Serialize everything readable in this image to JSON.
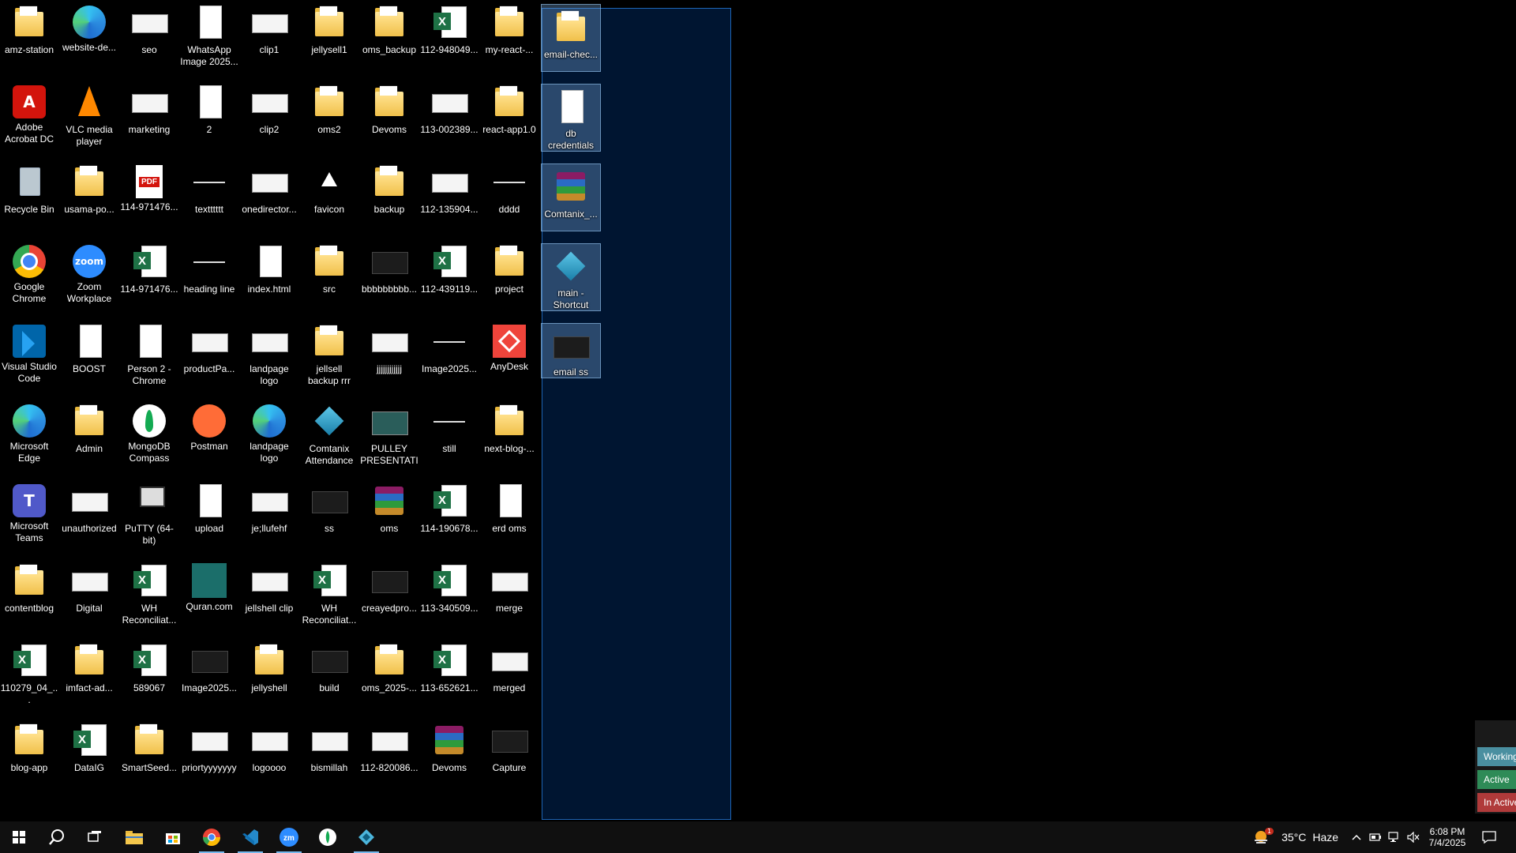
{
  "desktop": {
    "icons": [
      {
        "label": "amz-station",
        "icon": "folder-icon"
      },
      {
        "label": "website-de...",
        "icon": "edge-icon"
      },
      {
        "label": "seo",
        "icon": "thumbnail-icon"
      },
      {
        "label": "WhatsApp Image 2025...",
        "icon": "image-file-icon"
      },
      {
        "label": "clip1",
        "icon": "video-thumbnail-icon"
      },
      {
        "label": "jellysell1",
        "icon": "folder-icon"
      },
      {
        "label": "oms_backup",
        "icon": "folder-icon"
      },
      {
        "label": "112-948049...",
        "icon": "excel-icon"
      },
      {
        "label": "my-react-...",
        "icon": "folder-icon"
      },
      {
        "label": "Adobe Acrobat DC",
        "icon": "adobe-acrobat-icon"
      },
      {
        "label": "VLC media player",
        "icon": "vlc-icon"
      },
      {
        "label": "marketing",
        "icon": "thumbnail-icon"
      },
      {
        "label": "2",
        "icon": "document-icon"
      },
      {
        "label": "clip2",
        "icon": "video-thumbnail-icon"
      },
      {
        "label": "oms2",
        "icon": "folder-icon"
      },
      {
        "label": "Devoms",
        "icon": "folder-icon"
      },
      {
        "label": "113-002389...",
        "icon": "excel-thumbnail-icon"
      },
      {
        "label": "react-app1.0",
        "icon": "folder-icon"
      },
      {
        "label": "Recycle Bin",
        "icon": "recycle-bin-icon"
      },
      {
        "label": "usama-po...",
        "icon": "folder-icon"
      },
      {
        "label": "114-971476...",
        "icon": "pdf-icon"
      },
      {
        "label": "textttttt",
        "icon": "line-thumbnail-icon"
      },
      {
        "label": "onedirector...",
        "icon": "thumbnail-icon"
      },
      {
        "label": "favicon",
        "icon": "triangle-icon"
      },
      {
        "label": "backup",
        "icon": "folder-icon"
      },
      {
        "label": "112-135904...",
        "icon": "excel-thumbnail-icon"
      },
      {
        "label": "dddd",
        "icon": "line-thumbnail-icon"
      },
      {
        "label": "Google Chrome",
        "icon": "chrome-icon"
      },
      {
        "label": "Zoom Workplace",
        "icon": "zoom-icon"
      },
      {
        "label": "114-971476...",
        "icon": "excel-icon"
      },
      {
        "label": "heading line",
        "icon": "line-thumbnail-icon"
      },
      {
        "label": "index.html",
        "icon": "html-file-icon"
      },
      {
        "label": "src",
        "icon": "folder-icon"
      },
      {
        "label": "bbbbbbbbb...",
        "icon": "dark-thumbnail-icon"
      },
      {
        "label": "112-439119...",
        "icon": "excel-icon"
      },
      {
        "label": "project",
        "icon": "folder-icon"
      },
      {
        "label": "Visual Studio Code",
        "icon": "vscode-icon"
      },
      {
        "label": "BOOST",
        "icon": "document-icon"
      },
      {
        "label": "Person 2 - Chrome",
        "icon": "document-icon"
      },
      {
        "label": "productPa...",
        "icon": "thumbnail-icon"
      },
      {
        "label": "landpage logo",
        "icon": "thumbnail-icon"
      },
      {
        "label": "jellsell backup rrr",
        "icon": "folder-icon"
      },
      {
        "label": "jjjjjjjjjjjj",
        "icon": "thumbnail-icon"
      },
      {
        "label": "Image2025...",
        "icon": "line-thumbnail-icon"
      },
      {
        "label": "AnyDesk",
        "icon": "anydesk-icon"
      },
      {
        "label": "Microsoft Edge",
        "icon": "edge-icon"
      },
      {
        "label": "Admin",
        "icon": "folder-icon"
      },
      {
        "label": "MongoDB Compass",
        "icon": "mongodb-icon"
      },
      {
        "label": "Postman",
        "icon": "postman-icon"
      },
      {
        "label": "landpage logo",
        "icon": "edge-icon"
      },
      {
        "label": "Comtanix Attendance",
        "icon": "comtanix-icon"
      },
      {
        "label": "PULLEY PRESENTATI...",
        "icon": "powerpoint-icon"
      },
      {
        "label": "still",
        "icon": "line-thumbnail-icon"
      },
      {
        "label": "next-blog-...",
        "icon": "folder-icon"
      },
      {
        "label": "Microsoft Teams",
        "icon": "teams-icon"
      },
      {
        "label": "unauthorized",
        "icon": "thumbnail-icon"
      },
      {
        "label": "PuTTY (64-bit)",
        "icon": "putty-icon"
      },
      {
        "label": "upload",
        "icon": "document-icon"
      },
      {
        "label": "je;llufehf",
        "icon": "thumbnail-icon"
      },
      {
        "label": "ss",
        "icon": "dark-thumbnail-icon"
      },
      {
        "label": "oms",
        "icon": "winrar-icon"
      },
      {
        "label": "114-190678...",
        "icon": "excel-icon"
      },
      {
        "label": "erd oms",
        "icon": "document-icon"
      },
      {
        "label": "contentblog",
        "icon": "folder-icon"
      },
      {
        "label": "Digital",
        "icon": "thumbnail-icon"
      },
      {
        "label": "WH Reconciliat...",
        "icon": "excel-icon"
      },
      {
        "label": "Quran.com",
        "icon": "quran-icon"
      },
      {
        "label": "jellshell clip",
        "icon": "thumbnail-icon"
      },
      {
        "label": "WH Reconciliat...",
        "icon": "excel-icon"
      },
      {
        "label": "creayedpro...",
        "icon": "dark-thumbnail-icon"
      },
      {
        "label": "113-340509...",
        "icon": "excel-icon"
      },
      {
        "label": "merge",
        "icon": "thumbnail-icon"
      },
      {
        "label": "110279_04_...",
        "icon": "excel-icon"
      },
      {
        "label": "imfact-ad...",
        "icon": "folder-icon"
      },
      {
        "label": "589067",
        "icon": "excel-icon"
      },
      {
        "label": "Image2025...",
        "icon": "dark-thumbnail-icon"
      },
      {
        "label": "jellyshell",
        "icon": "folder-icon"
      },
      {
        "label": "build",
        "icon": "dark-thumbnail-icon"
      },
      {
        "label": "oms_2025-...",
        "icon": "folder-icon"
      },
      {
        "label": "113-652621...",
        "icon": "excel-icon"
      },
      {
        "label": "merged",
        "icon": "thumbnail-icon"
      },
      {
        "label": "blog-app",
        "icon": "folder-icon"
      },
      {
        "label": "DataIG",
        "icon": "excel-icon"
      },
      {
        "label": "SmartSeed...",
        "icon": "folder-icon"
      },
      {
        "label": "priortyyyyyyy",
        "icon": "thumbnail-icon"
      },
      {
        "label": "logoooo",
        "icon": "thumbnail-icon"
      },
      {
        "label": "bismillah",
        "icon": "thumbnail-icon"
      },
      {
        "label": "112-820086...",
        "icon": "excel-thumbnail-icon"
      },
      {
        "label": "Devoms",
        "icon": "winrar-icon"
      },
      {
        "label": "Capture",
        "icon": "dark-thumbnail-icon"
      }
    ],
    "selected_icons": [
      {
        "label": "email-chec...",
        "icon": "folder-icon"
      },
      {
        "label": "db credentials",
        "icon": "document-icon"
      },
      {
        "label": "Comtanix_...",
        "icon": "winrar-icon"
      },
      {
        "label": "main - Shortcut",
        "icon": "comtanix-icon"
      },
      {
        "label": "email ss",
        "icon": "dark-thumbnail-icon"
      }
    ]
  },
  "side_panel": {
    "buttons": [
      {
        "label": "Working",
        "color": "#4a8fa0"
      },
      {
        "label": "Active",
        "color": "#2e8b57"
      },
      {
        "label": "In Active",
        "color": "#b03a3a"
      }
    ]
  },
  "taskbar": {
    "apps": [
      {
        "name": "start-button",
        "icon": "windows-logo-icon"
      },
      {
        "name": "search-button",
        "icon": "search-icon"
      },
      {
        "name": "task-view-button",
        "icon": "task-view-icon"
      },
      {
        "name": "file-explorer",
        "icon": "folder-icon"
      },
      {
        "name": "microsoft-store",
        "icon": "store-icon"
      },
      {
        "name": "google-chrome",
        "icon": "chrome-icon"
      },
      {
        "name": "visual-studio-code",
        "icon": "vscode-icon"
      },
      {
        "name": "zoom",
        "icon": "zoom-icon"
      },
      {
        "name": "mongodb-compass",
        "icon": "mongodb-icon"
      },
      {
        "name": "comtanix",
        "icon": "comtanix-icon"
      }
    ],
    "weather": {
      "temp": "35°C",
      "condition": "Haze",
      "alert_count": "1"
    },
    "clock": {
      "time": "6:08 PM",
      "date": "7/4/2025"
    }
  }
}
